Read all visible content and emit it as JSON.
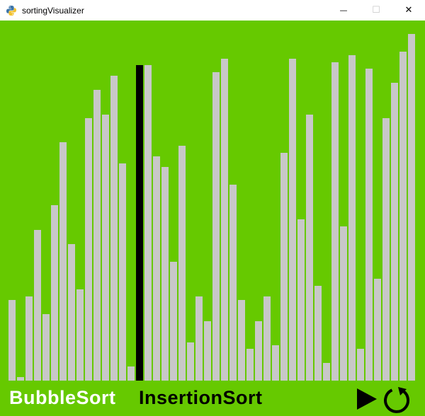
{
  "window": {
    "title": "sortingVisualizer",
    "app_icon": "python-snake-icon",
    "controls": {
      "minimize_icon": "minimize-icon",
      "maximize_icon": "maximize-icon",
      "close_icon": "close-icon",
      "minimize_glyph": "—",
      "maximize_glyph": "☐",
      "close_glyph": "✕"
    }
  },
  "colors": {
    "background": "#66c900",
    "bar": "#c8c8c8",
    "active_bar": "#000000",
    "selected_algorithm": "#ffffff",
    "unselected_algorithm": "#000000"
  },
  "bars": {
    "scale_max": 500,
    "values": [
      115,
      5,
      120,
      215,
      95,
      250,
      340,
      195,
      130,
      375,
      415,
      380,
      435,
      310,
      20,
      450,
      450,
      320,
      305,
      170,
      335,
      55,
      120,
      85,
      440,
      460,
      280,
      115,
      45,
      85,
      120,
      50,
      325,
      460,
      230,
      380,
      135,
      25,
      455,
      220,
      465,
      45,
      445,
      145,
      375,
      425,
      470,
      495
    ],
    "active_index": 15
  },
  "algorithms": {
    "selected": "BubbleSort",
    "items": [
      {
        "label": "BubbleSort"
      },
      {
        "label": "InsertionSort"
      }
    ]
  },
  "controls": {
    "play_icon": "play-icon",
    "reset_icon": "refresh-icon"
  }
}
